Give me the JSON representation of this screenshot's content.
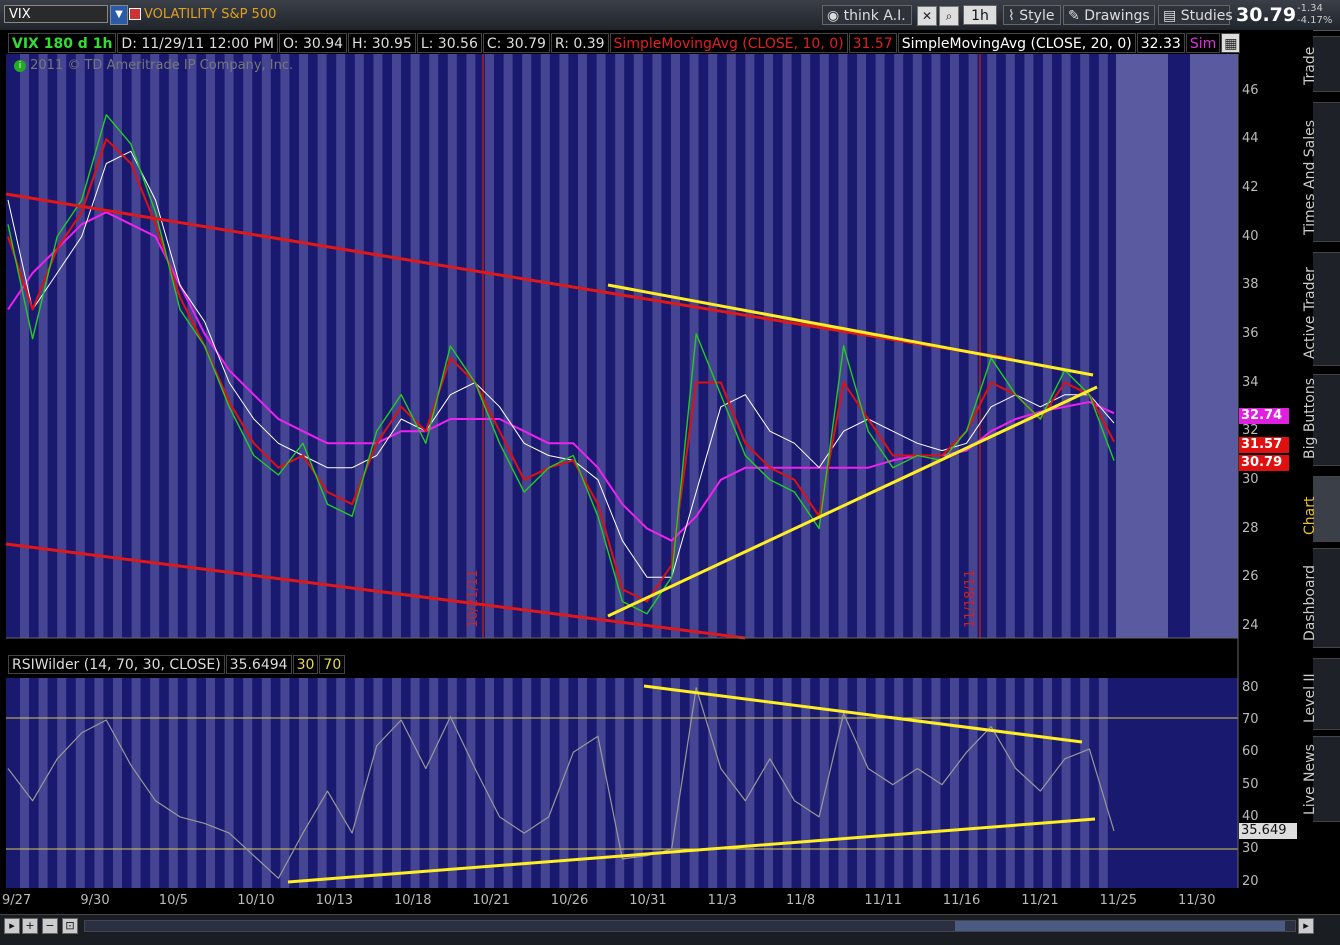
{
  "toolbar": {
    "symbol": "VIX",
    "symbol_name": "VOLATILITY S&P 500",
    "think_label": "think A.I.",
    "timeframe": "1h",
    "style_label": "Style",
    "drawings_label": "Drawings",
    "studies_label": "Studies",
    "last_price": "30.79",
    "change": "-1.34",
    "change_pct": "-4.17%"
  },
  "info": {
    "title": "VIX 180 d 1h",
    "date": "D: 11/29/11 12:00 PM",
    "open": "O: 30.94",
    "high": "H: 30.95",
    "low": "L: 30.56",
    "close": "C: 30.79",
    "range": "R: 0.39",
    "sma10_label": "SimpleMovingAvg (CLOSE, 10, 0)",
    "sma10_value": "31.57",
    "sma20_label": "SimpleMovingAvg (CLOSE, 20, 0)",
    "sma20_value": "32.33",
    "sim_label": "Sim"
  },
  "copyright": "2011 © TD Ameritrade IP Company, Inc.",
  "date_markers": [
    "10/21/11",
    "11/18/11"
  ],
  "price_tags": {
    "magenta": "32.74",
    "sma10": "31.57",
    "last": "30.79"
  },
  "rsi": {
    "label": "RSIWilder (14, 70, 30, CLOSE)",
    "value": "35.6494",
    "oversold": "30",
    "overbought": "70",
    "current_tag": "35.649"
  },
  "side_tabs": [
    "Trade",
    "Times And Sales",
    "Active Trader",
    "Big Buttons",
    "Chart",
    "Dashboard",
    "Level II",
    "Live News"
  ],
  "chart_data": [
    {
      "type": "line",
      "title": "VIX 180 d 1h",
      "x_ticks": [
        "9/27",
        "9/30",
        "10/5",
        "10/10",
        "10/13",
        "10/18",
        "10/21",
        "10/26",
        "10/31",
        "11/3",
        "11/8",
        "11/11",
        "11/16",
        "11/21",
        "11/25",
        "11/30"
      ],
      "ylim": [
        23.5,
        47.5
      ],
      "y_ticks": [
        24,
        26,
        28,
        30,
        32,
        34,
        36,
        38,
        40,
        42,
        44,
        46
      ],
      "series": [
        {
          "name": "VIX",
          "color": "#22cc22",
          "values": [
            40.5,
            35.8,
            40,
            41.5,
            45,
            43.8,
            41,
            37,
            35.5,
            33,
            31,
            30.2,
            31.5,
            29,
            28.5,
            32,
            33.5,
            31.5,
            35.5,
            34,
            31.5,
            29.5,
            30.5,
            31,
            28.5,
            25,
            24.5,
            26,
            36,
            33.5,
            31,
            30,
            29.5,
            28,
            35.5,
            32,
            30.5,
            31,
            30.8,
            32,
            35,
            33.5,
            32.5,
            34.5,
            33.5,
            30.79
          ]
        },
        {
          "name": "SimpleMovingAvg (CLOSE, 10, 0)",
          "color": "#dd1111",
          "values": [
            40,
            37,
            39.5,
            41,
            44,
            43,
            40.5,
            37.5,
            35.5,
            33.2,
            31.5,
            30.5,
            31,
            29.5,
            29,
            31.5,
            33,
            32,
            35,
            34,
            32,
            30,
            30.5,
            30.8,
            29,
            25.5,
            25,
            26.5,
            34,
            34,
            31.5,
            30.5,
            30,
            28.5,
            34,
            32.5,
            31,
            31,
            31,
            32,
            34,
            33.5,
            32.5,
            34,
            33.5,
            31.57
          ]
        },
        {
          "name": "SimpleMovingAvg (CLOSE, 20, 0)",
          "color": "#ffffff",
          "values": [
            41.5,
            37,
            38.5,
            40,
            43,
            43.5,
            41.5,
            38,
            36.5,
            34,
            32.5,
            31.5,
            31,
            30.5,
            30.5,
            31,
            32.5,
            32,
            33.5,
            34,
            33,
            31.5,
            31,
            30.8,
            30,
            27.5,
            26,
            26,
            29.5,
            33,
            33.5,
            32,
            31.5,
            30.5,
            32,
            32.5,
            32,
            31.5,
            31.2,
            31.5,
            33,
            33.5,
            33,
            33.5,
            33.5,
            32.33
          ]
        },
        {
          "name": "Sim",
          "color": "#ee22ee",
          "values": [
            37,
            38.5,
            39.5,
            40.5,
            41,
            40.5,
            40,
            38,
            36,
            34.5,
            33.5,
            32.5,
            32,
            31.5,
            31.5,
            31.5,
            32,
            32,
            32.5,
            32.5,
            32.5,
            32,
            31.5,
            31.5,
            30.5,
            29,
            28,
            27.5,
            28.5,
            30,
            30.5,
            30.5,
            30.5,
            30.5,
            30.5,
            30.5,
            30.8,
            31,
            31,
            31.2,
            32,
            32.5,
            32.8,
            33,
            33.2,
            32.74
          ]
        }
      ]
    },
    {
      "type": "line",
      "title": "RSIWilder (14, 70, 30, CLOSE)",
      "ylim": [
        18,
        83
      ],
      "y_ticks": [
        20,
        30,
        40,
        50,
        60,
        70,
        80
      ],
      "series": [
        {
          "name": "RSIWilder (14, 70, 30, CLOSE)",
          "color": "#999999",
          "values": [
            55,
            45,
            58,
            66,
            70,
            56,
            45,
            40,
            38,
            35,
            28,
            21,
            35,
            48,
            35,
            62,
            70,
            55,
            71,
            55,
            40,
            35,
            40,
            60,
            65,
            27,
            28,
            30,
            80,
            55,
            45,
            58,
            45,
            40,
            72,
            55,
            50,
            55,
            50,
            60,
            68,
            55,
            48,
            58,
            61,
            35.65
          ]
        }
      ]
    }
  ]
}
